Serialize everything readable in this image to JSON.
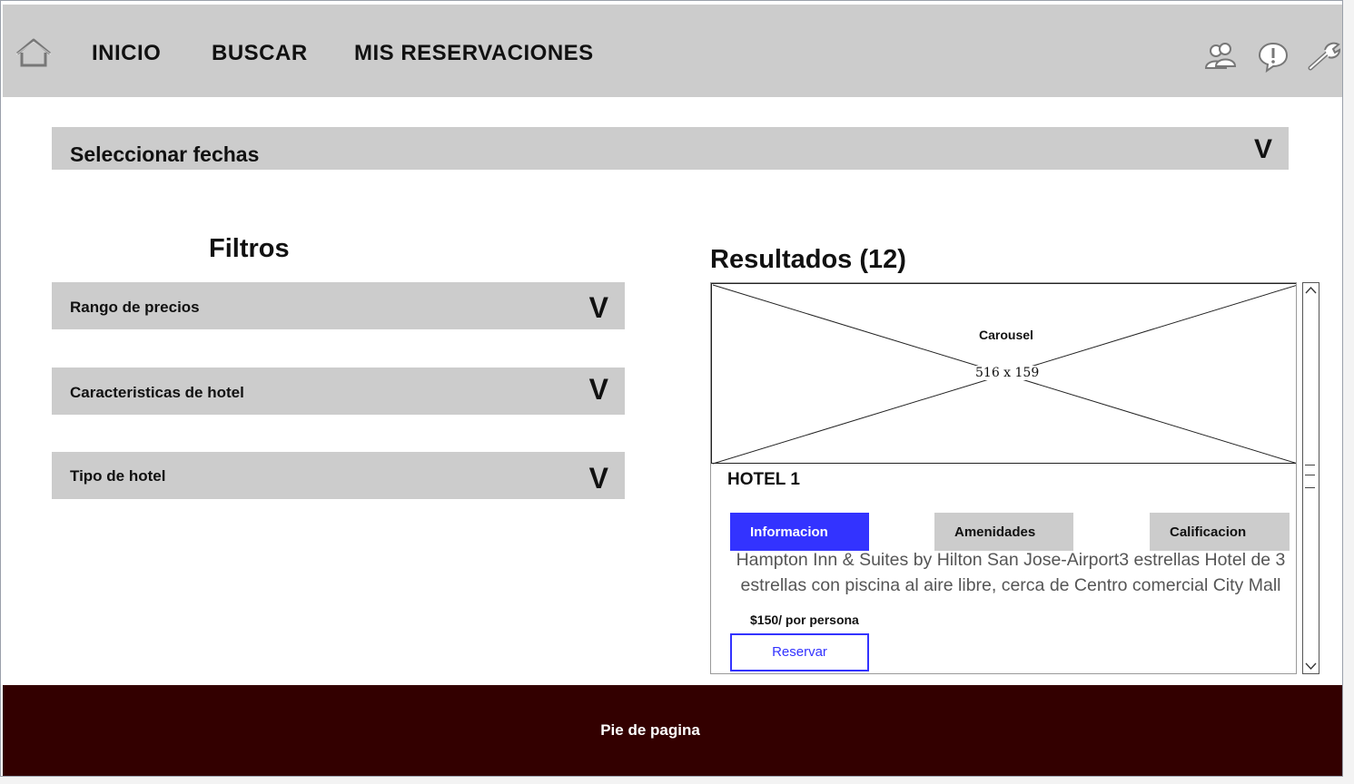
{
  "nav": {
    "items": [
      "INICIO",
      "BUSCAR",
      "MIS RESERVACIONES"
    ]
  },
  "header_icons": [
    "home-icon",
    "users-icon",
    "alert-icon",
    "wrench-icon"
  ],
  "dates": {
    "label": "Seleccionar fechas",
    "chevron": "V"
  },
  "filters": {
    "title": "Filtros",
    "items": [
      {
        "label": "Rango de precios",
        "chevron": "V"
      },
      {
        "label": "Caracteristicas de hotel",
        "chevron": "V"
      },
      {
        "label": "Tipo de hotel",
        "chevron": "V"
      }
    ]
  },
  "results": {
    "title": "Resultados (12)",
    "carousel": {
      "label": "Carousel",
      "dimensions": "516 x 159"
    },
    "hotel": {
      "name": "HOTEL 1",
      "tabs": [
        "Informacion",
        "Amenidades",
        "Calificacion"
      ],
      "description": "Hampton Inn & Suites by Hilton San Jose-Airport3 estrellas Hotel de 3 estrellas con piscina al aire libre, cerca de Centro comercial City Mall",
      "price": "$150/ por persona",
      "reserve_label": "Reservar"
    }
  },
  "footer": {
    "text": "Pie de pagina"
  },
  "colors": {
    "header_bg": "#cccccc",
    "accent": "#3333ff",
    "footer_bg": "#330000",
    "panel_bg": "#cccccc"
  }
}
